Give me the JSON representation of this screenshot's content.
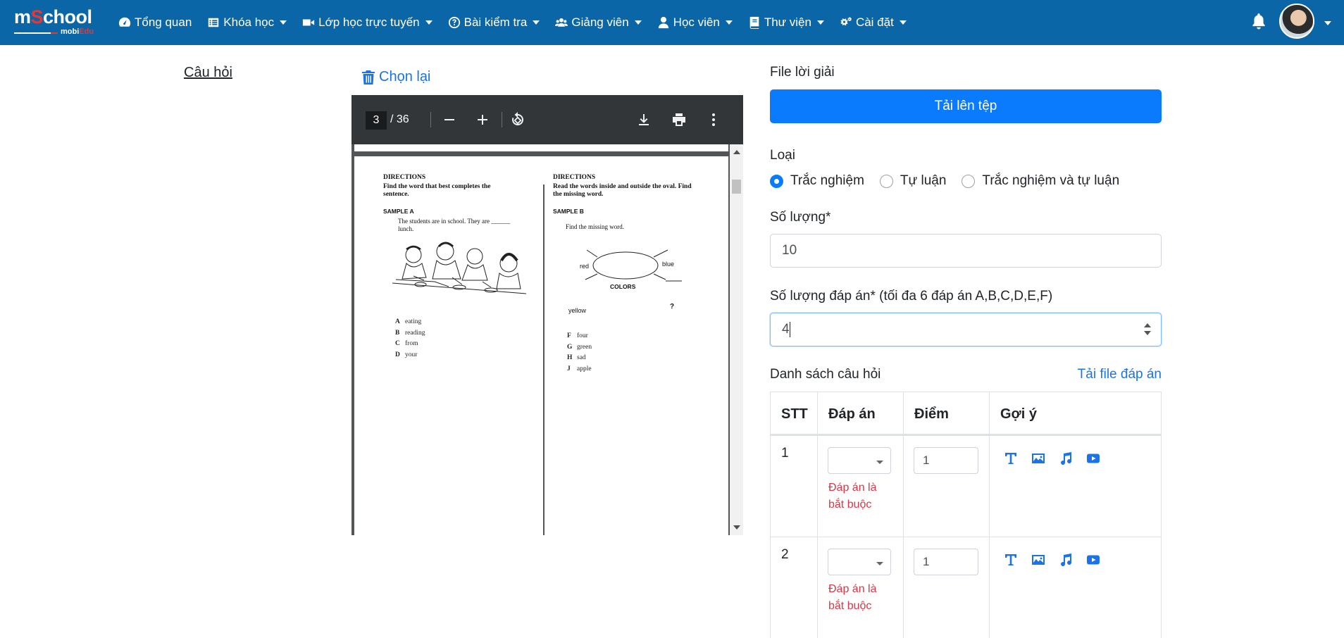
{
  "navbar": {
    "logo_main_1": "m",
    "logo_main_s": "S",
    "logo_main_2": "chool",
    "logo_sub_1": "mobi",
    "logo_sub_2": "Edu",
    "items": [
      {
        "label": "Tổng quan",
        "icon": "dashboard-icon",
        "caret": false
      },
      {
        "label": "Khóa học",
        "icon": "list-icon",
        "caret": true
      },
      {
        "label": "Lớp học trực tuyến",
        "icon": "video-icon",
        "caret": true
      },
      {
        "label": "Bài kiểm tra",
        "icon": "question-circle-icon",
        "caret": true
      },
      {
        "label": "Giảng viên",
        "icon": "users-icon",
        "caret": true
      },
      {
        "label": "Học viên",
        "icon": "user-icon",
        "caret": true
      },
      {
        "label": "Thư viện",
        "icon": "book-icon",
        "caret": true
      },
      {
        "label": "Cài đặt",
        "icon": "gears-icon",
        "caret": true
      }
    ]
  },
  "left": {
    "title": "Câu hỏi"
  },
  "pdf": {
    "reset_label": "Chọn lại",
    "current_page": "3",
    "total_pages": "/ 36",
    "page": {
      "left_directions": "DIRECTIONS",
      "left_instruction": "Find the word that best completes the sentence.",
      "left_sample": "SAMPLE A",
      "left_sentence": "The students are in school. They are ______ lunch.",
      "left_options": [
        {
          "letter": "A",
          "text": "eating"
        },
        {
          "letter": "B",
          "text": "reading"
        },
        {
          "letter": "C",
          "text": "from"
        },
        {
          "letter": "D",
          "text": "your"
        }
      ],
      "right_directions": "DIRECTIONS",
      "right_instruction": "Read the words inside and outside the oval. Find the missing word.",
      "right_sample": "SAMPLE B",
      "right_sentence": "Find the missing word.",
      "oval_center": "COLORS",
      "oval_words": [
        "red",
        "blue",
        "yellow",
        "?"
      ],
      "right_options": [
        {
          "letter": "F",
          "text": "four"
        },
        {
          "letter": "G",
          "text": "green"
        },
        {
          "letter": "H",
          "text": "sad"
        },
        {
          "letter": "J",
          "text": "apple"
        }
      ]
    }
  },
  "form": {
    "solution_label": "File lời giải",
    "upload_label": "Tải lên tệp",
    "type_label": "Loại",
    "types": [
      {
        "label": "Trắc nghiệm",
        "selected": true
      },
      {
        "label": "Tự luận",
        "selected": false
      },
      {
        "label": "Trắc nghiệm và tự luận",
        "selected": false
      }
    ],
    "quantity_label": "Số lượng*",
    "quantity_value": "10",
    "answers_label": "Số lượng đáp án* (tối đa 6 đáp án A,B,C,D,E,F)",
    "answers_value": "4",
    "list_label": "Danh sách câu hỏi",
    "download_answers": "Tải file đáp án",
    "table": {
      "headers": [
        "STT",
        "Đáp án",
        "Điểm",
        "Gợi ý"
      ],
      "rows": [
        {
          "stt": "1",
          "answer": "",
          "error": "Đáp án là bắt buộc",
          "score": "1"
        },
        {
          "stt": "2",
          "answer": "",
          "error": "Đáp án là bắt buộc",
          "score": "1"
        }
      ],
      "hint_icons": [
        "text-icon",
        "image-icon",
        "music-icon",
        "youtube-icon"
      ]
    }
  },
  "colors": {
    "navbar": "#0b66a8",
    "primary": "#0b7bfe",
    "link": "#1a73e8",
    "error": "#dc3545"
  }
}
